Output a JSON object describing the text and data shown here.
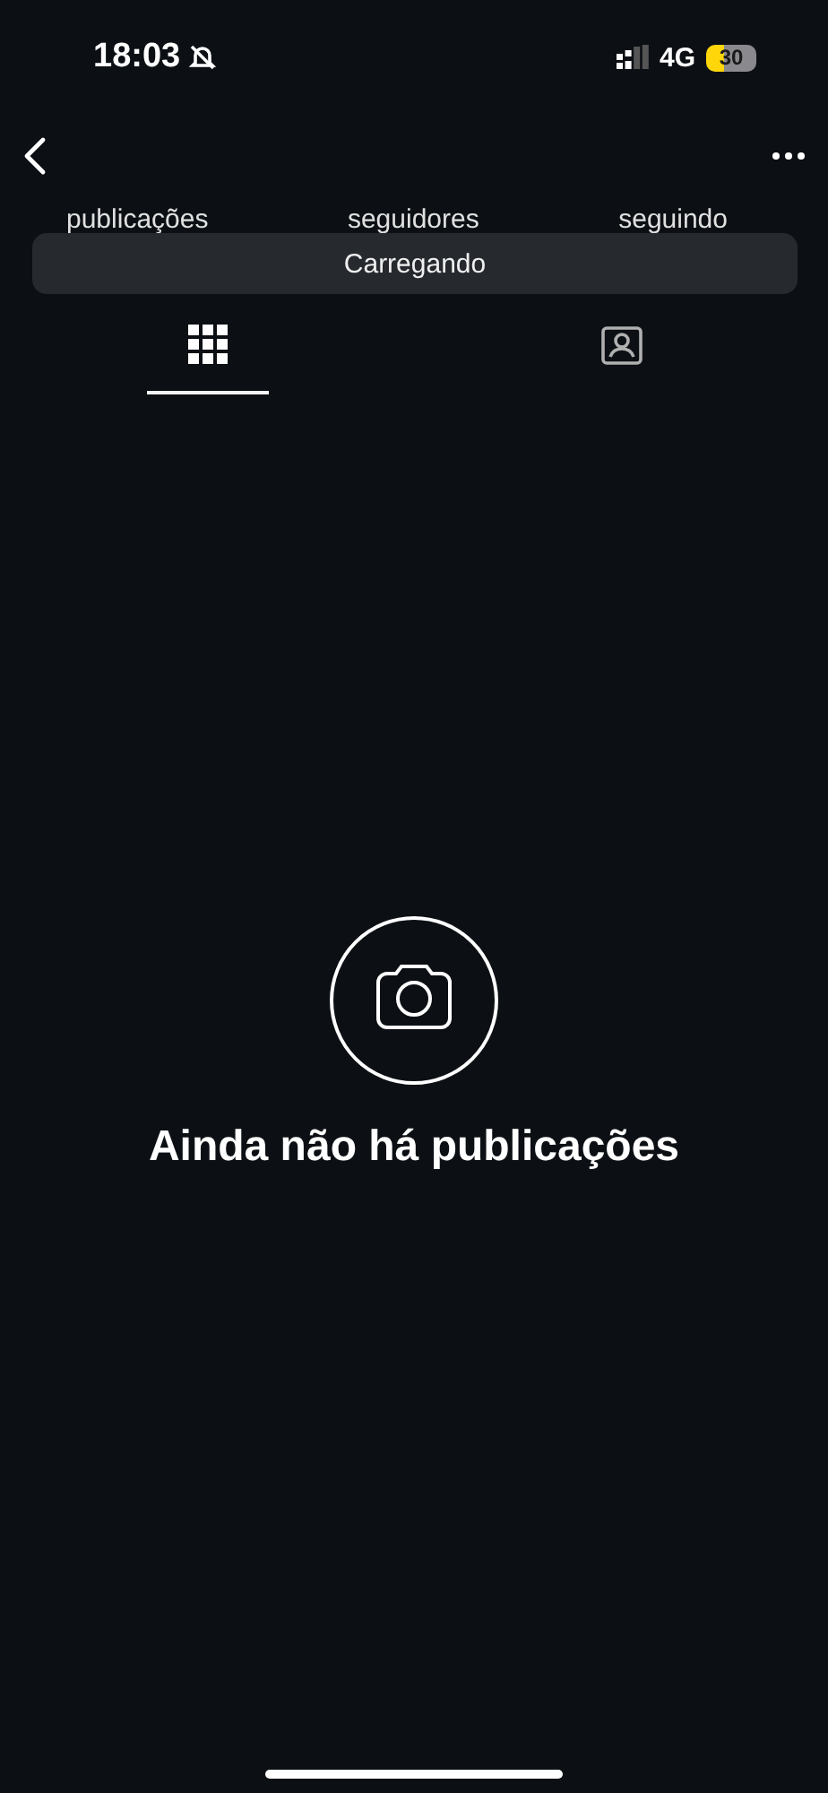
{
  "status_bar": {
    "time": "18:03",
    "network": "4G",
    "battery": "30"
  },
  "stats": [
    {
      "label": "publicações"
    },
    {
      "label": "seguidores"
    },
    {
      "label": "seguindo"
    }
  ],
  "toast": {
    "text": "Carregando"
  },
  "tabs": [
    {
      "kind": "grid",
      "selected": true
    },
    {
      "kind": "tagged",
      "selected": false
    }
  ],
  "empty_state": {
    "title": "Ainda não há publicações"
  }
}
